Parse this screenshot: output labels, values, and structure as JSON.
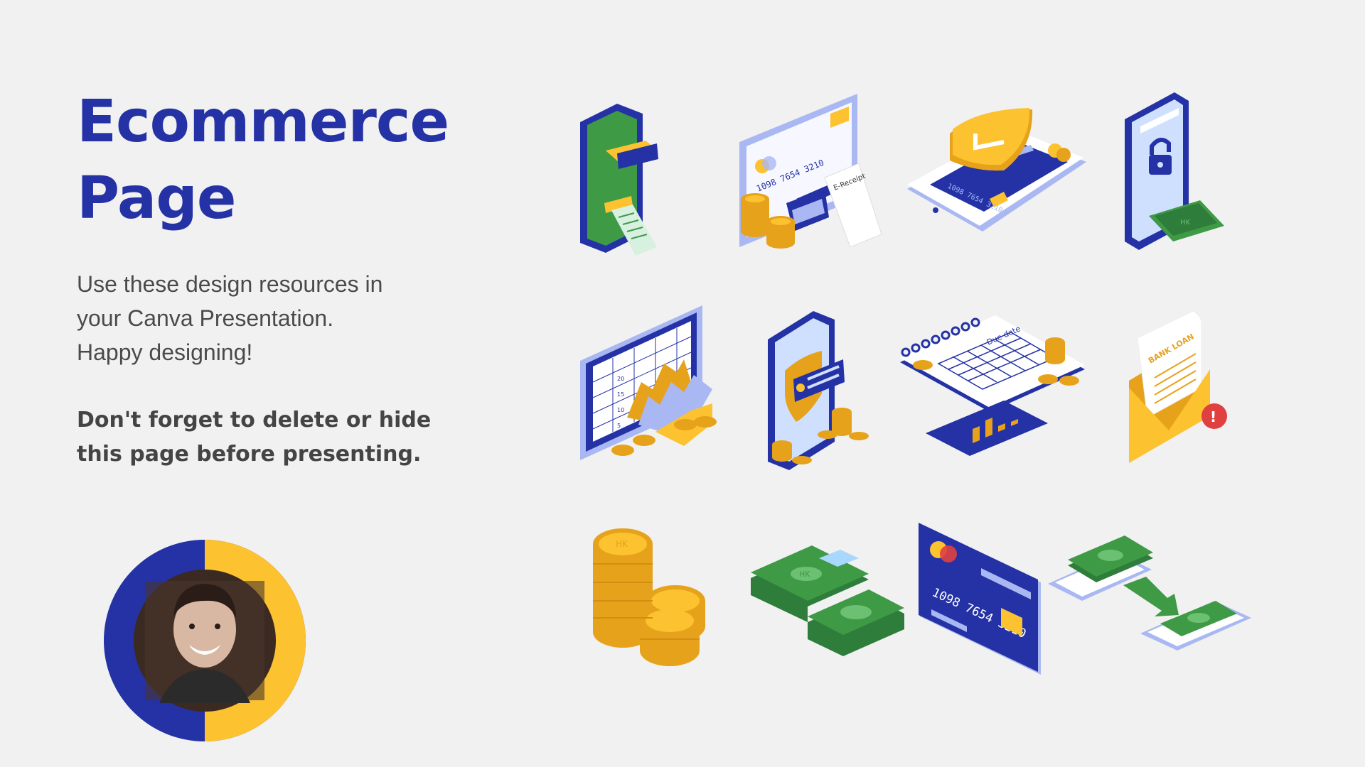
{
  "title": {
    "line1": "Ecommerce",
    "line2": "Page"
  },
  "description": {
    "line1": "Use these design resources in",
    "line2": "your Canva Presentation.",
    "line3": "Happy designing!"
  },
  "reminder": {
    "line1": "Don't forget to delete or hide",
    "line2": "this page before presenting."
  },
  "illustrations": {
    "card_number": "1098 7654 3210",
    "receipt_label": "E-Receipt",
    "due_date_label": "Due date",
    "bank_loan_label": "BANK LOAN",
    "currency_symbol": "HK",
    "chart_ticks": [
      "20",
      "15",
      "10",
      "5"
    ],
    "alert_mark": "!"
  },
  "colors": {
    "background": "#f1f1f1",
    "navy": "#2432a6",
    "light_blue": "#a9b8f2",
    "gold": "#e7a21c",
    "yellow": "#fcc22f",
    "green": "#3f9a46",
    "red": "#e04040"
  }
}
